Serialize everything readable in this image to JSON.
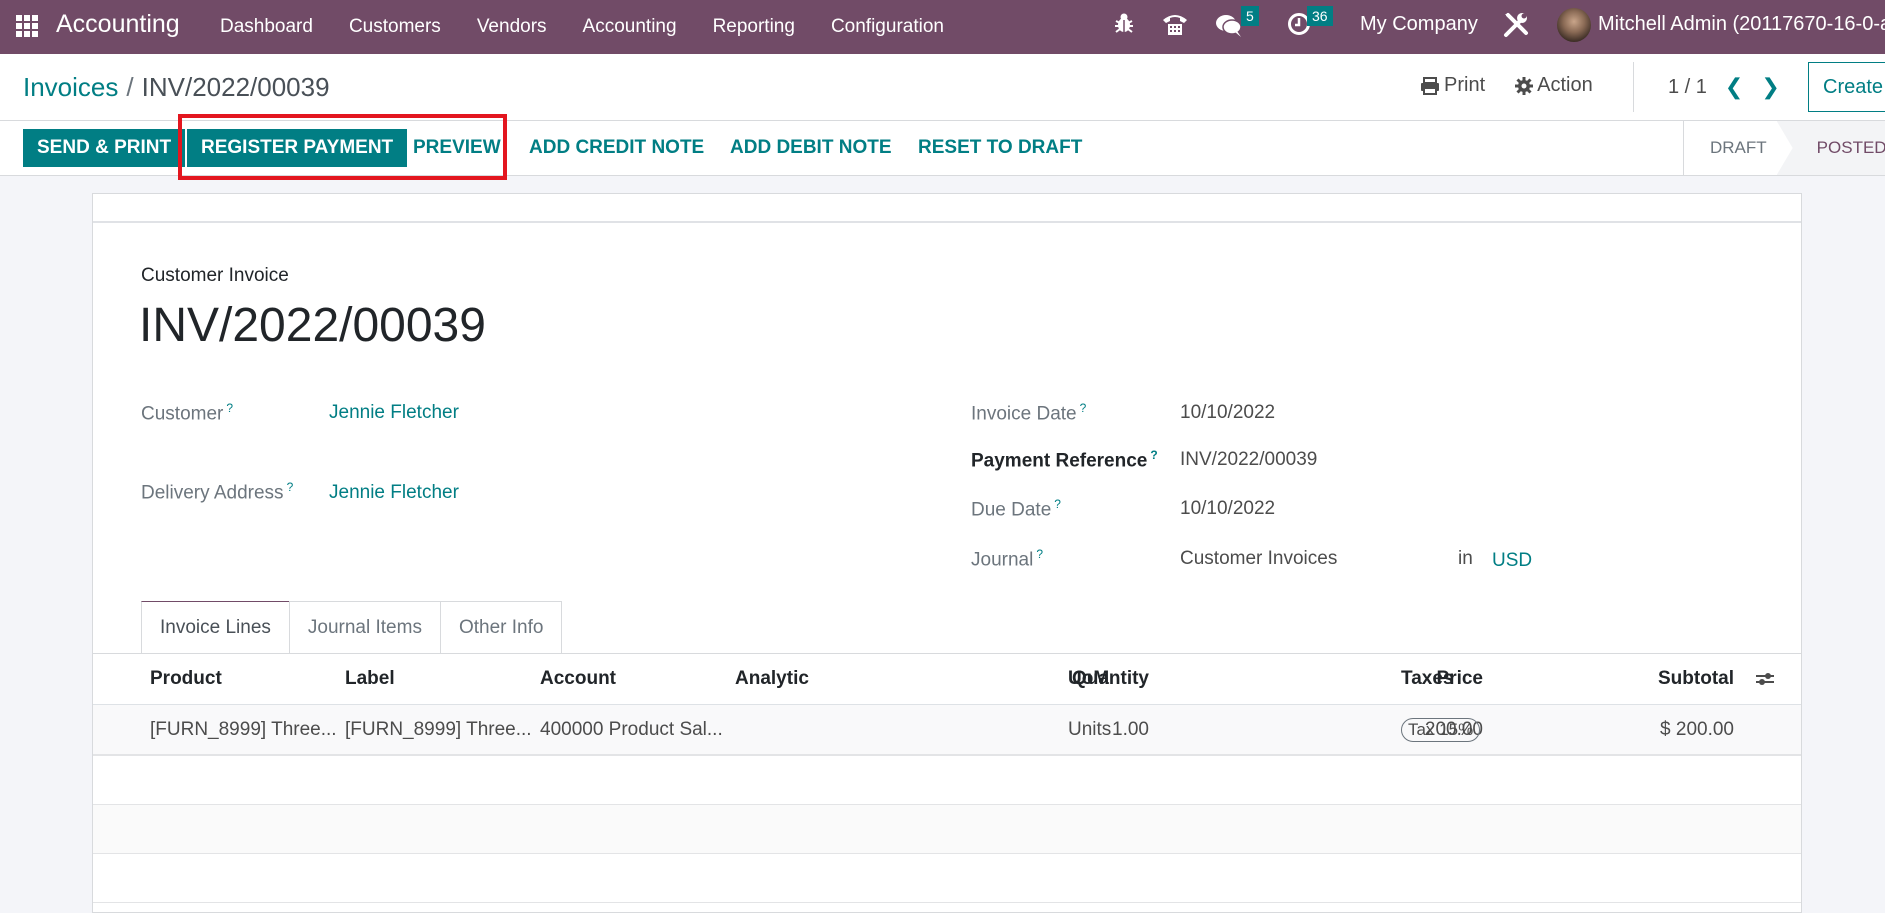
{
  "navbar": {
    "app_name": "Accounting",
    "menu": [
      "Dashboard",
      "Customers",
      "Vendors",
      "Accounting",
      "Reporting",
      "Configuration"
    ],
    "messages_count": "5",
    "activities_count": "36",
    "company": "My Company",
    "user": "Mitchell Admin (20117670-16-0-a"
  },
  "breadcrumb": {
    "parent": "Invoices",
    "separator": "/",
    "current": "INV/2022/00039"
  },
  "control_panel": {
    "print_label": "Print",
    "action_label": "Action",
    "pager": "1 / 1",
    "create_label": "Create"
  },
  "buttons": {
    "send_print": "SEND & PRINT",
    "register_payment": "REGISTER PAYMENT",
    "preview": "PREVIEW",
    "add_credit_note": "ADD CREDIT NOTE",
    "add_debit_note": "ADD DEBIT NOTE",
    "reset_to_draft": "RESET TO DRAFT"
  },
  "status": {
    "steps": [
      "DRAFT",
      "POSTED"
    ],
    "current": "POSTED"
  },
  "highlight_color": "#e3161f",
  "accent_color": "#017e84",
  "brand_color": "#714b67",
  "form": {
    "doc_type": "Customer Invoice",
    "title": "INV/2022/00039",
    "help_mark": "?",
    "customer_label": "Customer",
    "customer": "Jennie Fletcher",
    "delivery_label": "Delivery Address",
    "delivery": "Jennie Fletcher",
    "invoice_date_label": "Invoice Date",
    "invoice_date": "10/10/2022",
    "payment_ref_label": "Payment Reference",
    "payment_ref": "INV/2022/00039",
    "due_date_label": "Due Date",
    "due_date": "10/10/2022",
    "journal_label": "Journal",
    "journal": "Customer Invoices",
    "in_label": "in",
    "currency": "USD"
  },
  "tabs": [
    "Invoice Lines",
    "Journal Items",
    "Other Info"
  ],
  "table": {
    "headers": {
      "product": "Product",
      "label": "Label",
      "account": "Account",
      "analytic": "Analytic",
      "quantity": "Quantity",
      "uom": "UoM",
      "price": "Price",
      "taxes": "Taxes",
      "subtotal": "Subtotal"
    },
    "rows": [
      {
        "product": "[FURN_8999] Three...",
        "label": "[FURN_8999] Three...",
        "account": "400000 Product Sal...",
        "analytic": "",
        "quantity": "1.00",
        "uom": "Units",
        "price": "200.00",
        "taxes": "Tax 15%",
        "subtotal": "$ 200.00"
      }
    ]
  }
}
